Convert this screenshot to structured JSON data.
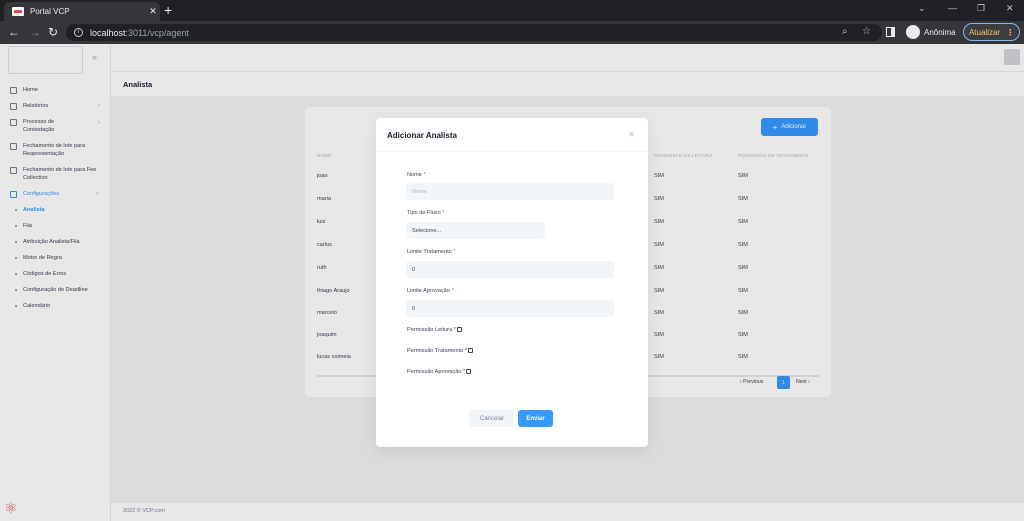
{
  "browser": {
    "tab_title": "Portal VCP",
    "tab_close": "✕",
    "new_tab": "+",
    "url_host": "localhost",
    "url_path": ":3011/vcp/agent",
    "profile_label": "Anônima",
    "update_label": "Atualizar",
    "back": "←",
    "forward": "→",
    "reload": "↻",
    "min": "⌄",
    "minimize": "—",
    "restore": "❐",
    "close": "✕"
  },
  "sidebar": {
    "collapse_icon": "»",
    "items": [
      {
        "label": "Home",
        "icon": "home-icon"
      },
      {
        "label": "Relatórios",
        "icon": "chart-icon",
        "chevron": "›"
      },
      {
        "label": "Processo de Contestação",
        "icon": "folder-icon",
        "chevron": "›"
      },
      {
        "label": "Fechamento de lote para Reapresentação",
        "icon": "card-icon"
      },
      {
        "label": "Fechamento de lote para Fee Collection",
        "icon": "card-icon"
      },
      {
        "label": "Configurações",
        "icon": "tools-icon",
        "chevron": "⌄"
      }
    ],
    "subitems": [
      {
        "label": "Analista"
      },
      {
        "label": "Fila"
      },
      {
        "label": "Atribuição Analista/Fila"
      },
      {
        "label": "Motor de Regra"
      },
      {
        "label": "Códigos de Erros"
      },
      {
        "label": "Configuração de Deadline"
      },
      {
        "label": "Calendário"
      }
    ]
  },
  "page": {
    "title": "Analista",
    "add_button": "Adicionar",
    "add_button_icon": "+",
    "columns": [
      "NOME",
      "PERMISSÃO DE LEITURA",
      "PERMISSÃO DE TRATAMENTO"
    ],
    "rows": [
      {
        "name": "joao",
        "read": "SIM",
        "treat": "SIM"
      },
      {
        "name": "maria",
        "read": "SIM",
        "treat": "SIM"
      },
      {
        "name": "luiz",
        "read": "SIM",
        "treat": "SIM"
      },
      {
        "name": "carlos",
        "read": "SIM",
        "treat": "SIM"
      },
      {
        "name": "ruth",
        "read": "SIM",
        "treat": "SIM"
      },
      {
        "name": "thiago Araujo",
        "read": "SIM",
        "treat": "SIM"
      },
      {
        "name": "marcelo",
        "read": "SIM",
        "treat": "SIM"
      },
      {
        "name": "joaquim",
        "read": "SIM",
        "treat": "SIM"
      },
      {
        "name": "lucas coimeia",
        "read": "SIM",
        "treat": "SIM"
      }
    ],
    "pager_prev": "‹ Previous",
    "pager_current": "1",
    "pager_next": "Next ›",
    "footer": "2022 © VCP.com"
  },
  "modal": {
    "title": "Adicionar Analista",
    "close_icon": "✕",
    "name_label": "Nome",
    "name_placeholder": "Nome",
    "flow_label": "Tipo de Fluxo",
    "flow_value": "Selecione...",
    "limit_treat_label": "Limite Tratamento",
    "limit_treat_value": "0",
    "limit_approve_label": "Limite Aprovação",
    "limit_approve_value": "0",
    "perm_read_label": "Permissão Leitura",
    "perm_treat_label": "Permissão Tratamento",
    "perm_approve_label": "Permissão Aprovação",
    "required_mark": "*",
    "cancel_label": "Cancelar",
    "submit_label": "Enviar"
  },
  "colors": {
    "accent": "#3699ff",
    "required": "#f64e60",
    "browser_dark": "#202124",
    "update_border": "#8ab4f8"
  }
}
